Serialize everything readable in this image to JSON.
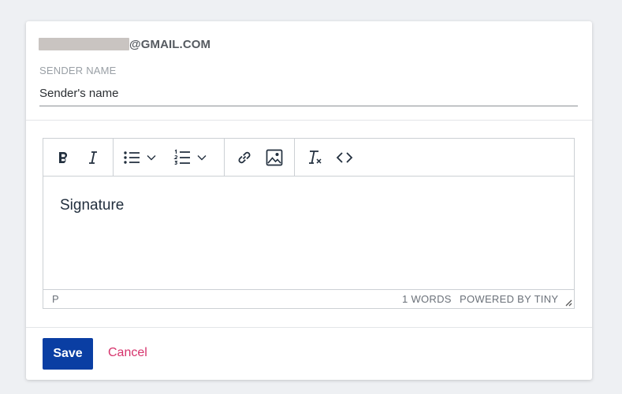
{
  "account": {
    "email_domain": "@GMAIL.COM"
  },
  "sender": {
    "label": "SENDER NAME",
    "value": "Sender's name"
  },
  "toolbar": {
    "icons": [
      "bold-icon",
      "italic-icon",
      "bullet-list-icon",
      "numbered-list-icon",
      "link-icon",
      "image-icon",
      "clear-formatting-icon",
      "source-code-icon"
    ]
  },
  "editor": {
    "content": "Signature",
    "path": "P",
    "word_count": "1 WORDS",
    "branding": "POWERED BY TINY"
  },
  "actions": {
    "save_label": "Save",
    "cancel_label": "Cancel"
  },
  "colors": {
    "primary": "#0a3ea3",
    "cancel": "#d6336c"
  }
}
